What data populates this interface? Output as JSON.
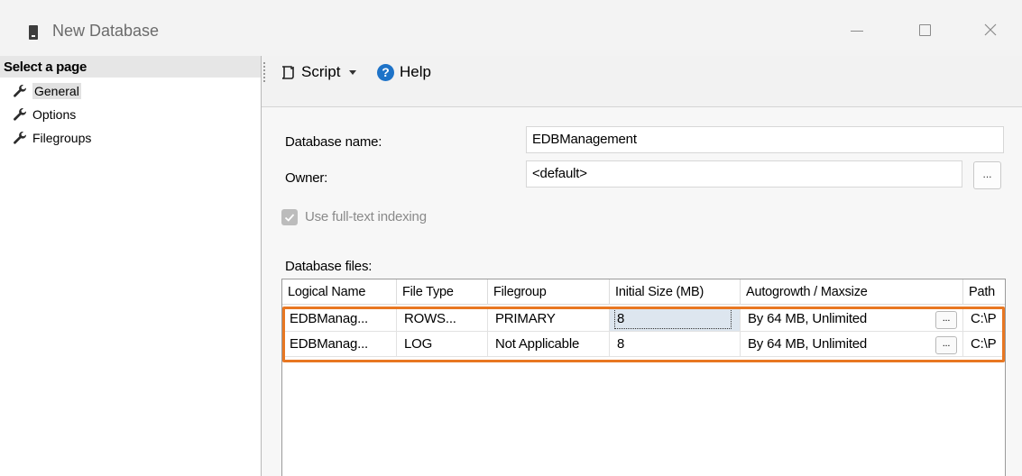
{
  "window": {
    "title": "New Database"
  },
  "left_panel": {
    "header": "Select a page",
    "items": [
      {
        "label": "General",
        "selected": true
      },
      {
        "label": "Options",
        "selected": false
      },
      {
        "label": "Filegroups",
        "selected": false
      }
    ]
  },
  "toolbar": {
    "script_label": "Script",
    "help_label": "Help"
  },
  "form": {
    "database_name_label": "Database name:",
    "database_name_value": "EDBManagement",
    "owner_label": "Owner:",
    "owner_value": "<default>",
    "owner_browse_label": "...",
    "fulltext_label": "Use full-text indexing",
    "fulltext_checked": true,
    "database_files_label": "Database files:"
  },
  "files_grid": {
    "columns": [
      "Logical Name",
      "File Type",
      "Filegroup",
      "Initial Size (MB)",
      "Autogrowth / Maxsize",
      "Path"
    ],
    "rows": [
      {
        "logical_name": "EDBManag...",
        "file_type": "ROWS...",
        "filegroup": "PRIMARY",
        "initial_size": "8",
        "autogrowth": "By 64 MB, Unlimited",
        "autogrowth_btn": "...",
        "path": "C:\\P"
      },
      {
        "logical_name": "EDBManag...",
        "file_type": "LOG",
        "filegroup": "Not Applicable",
        "initial_size": "8",
        "autogrowth": "By 64 MB, Unlimited",
        "autogrowth_btn": "...",
        "path": "C:\\P"
      }
    ]
  },
  "colors": {
    "highlight": "#e87722",
    "selected_cell": "#dde6ef",
    "help_icon": "#1e73c8"
  }
}
